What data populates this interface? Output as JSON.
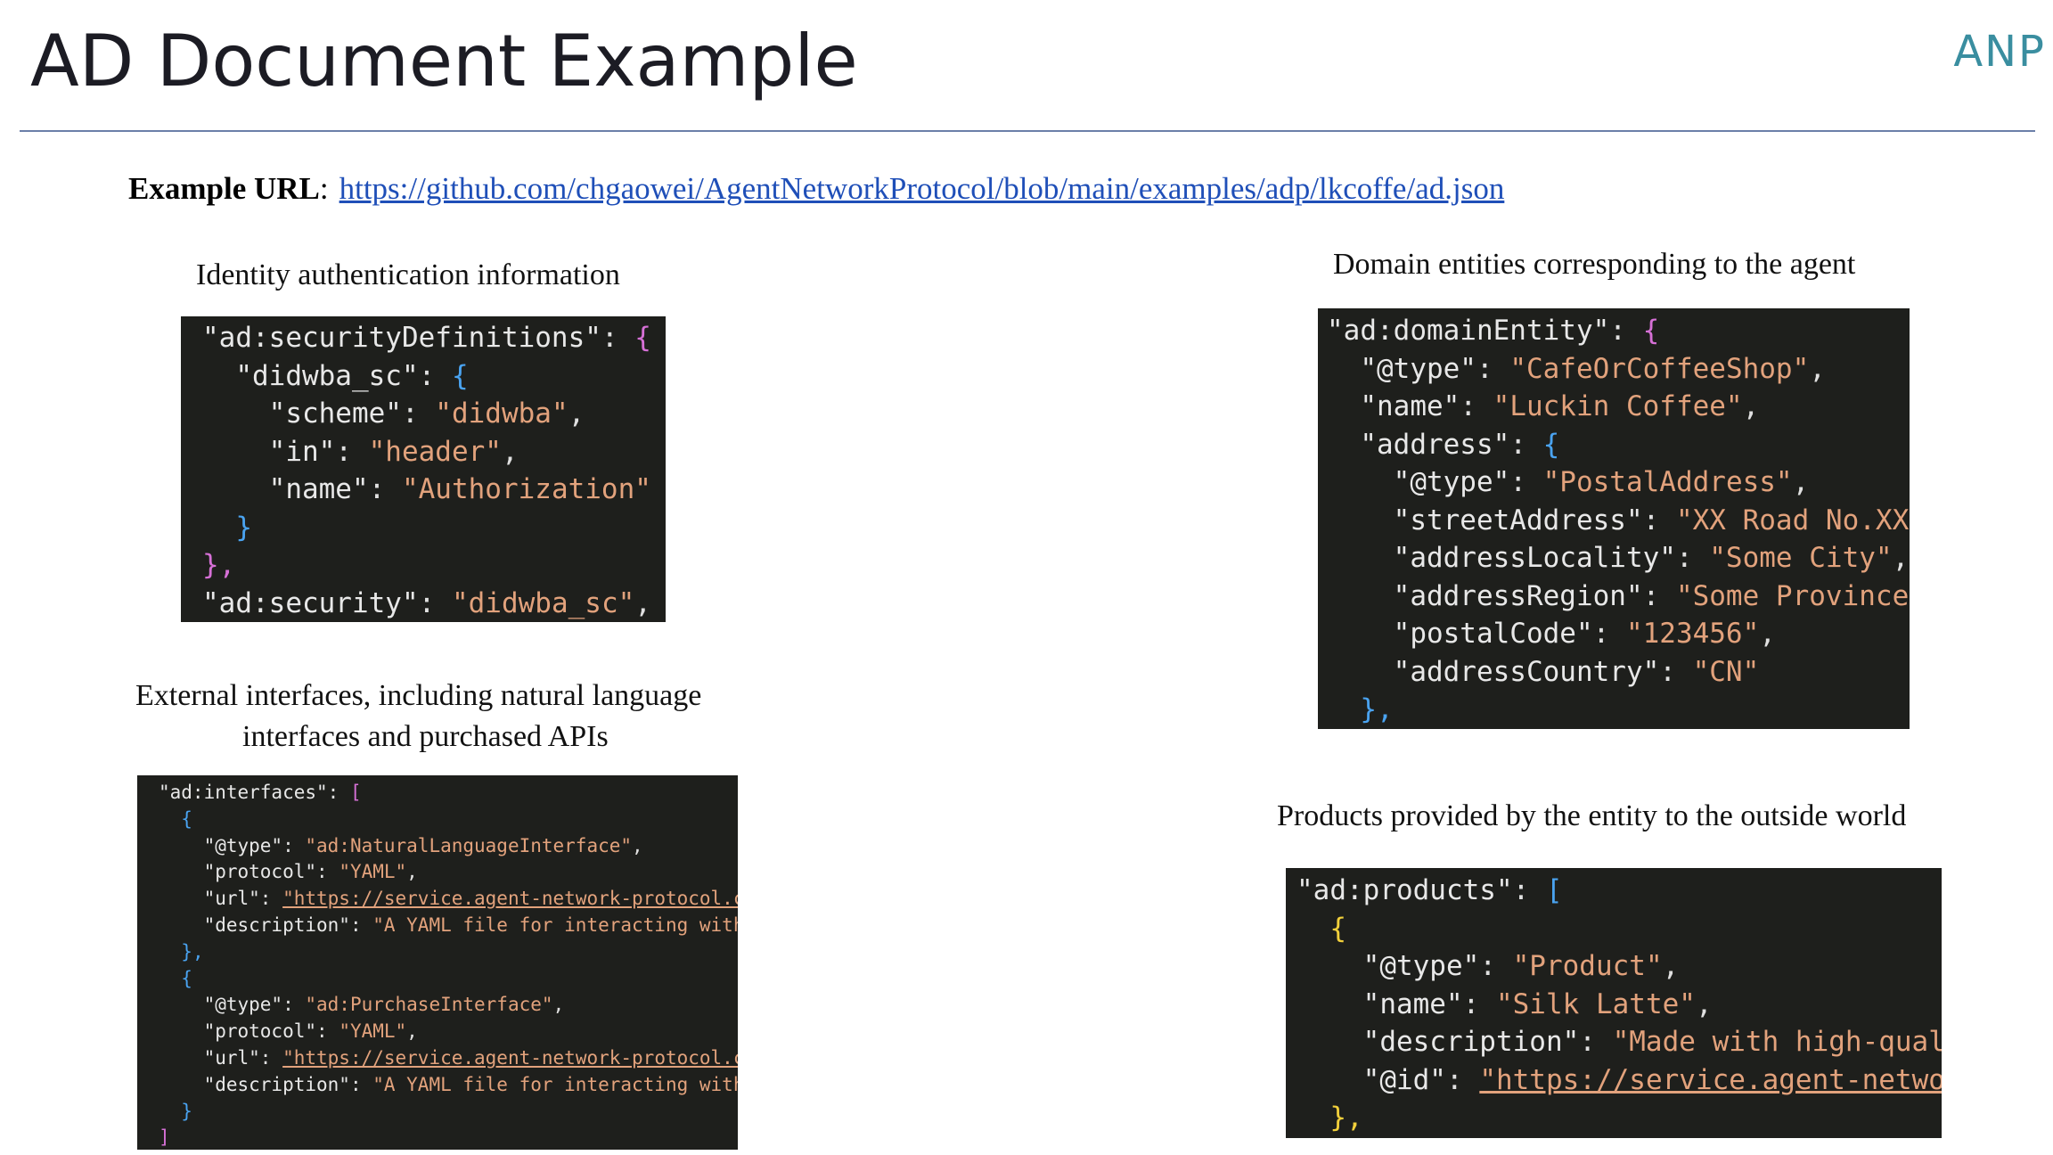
{
  "header": {
    "title": "AD Document Example",
    "logo_text": "ANP",
    "logo_color": "#3a8ea0"
  },
  "example_url": {
    "label": "Example URL",
    "separator": ":",
    "href": "https://github.com/chgaowei/AgentNetworkProtocol/blob/main/examples/adp/lkcoffe/ad.json"
  },
  "captions": {
    "identity": "Identity authentication information",
    "external_line1": "External interfaces, including natural language",
    "external_line2": "interfaces and purchased APIs",
    "domain": "Domain entities corresponding to the agent",
    "products": "Products provided by the entity to the outside world"
  },
  "code_security": [
    [
      "\"ad:securityDefinitions\"",
      ": ",
      "",
      "{",
      "b1"
    ],
    [
      "  \"didwba_sc\"",
      ": ",
      "",
      "{",
      "b2"
    ],
    [
      "    \"scheme\"",
      ": ",
      "\"didwba\"",
      ",",
      ""
    ],
    [
      "    \"in\"",
      ": ",
      "\"header\"",
      ",",
      ""
    ],
    [
      "    \"name\"",
      ": ",
      "\"Authorization\"",
      "",
      ""
    ],
    [
      "  ",
      "",
      "",
      "}",
      "b2"
    ],
    [
      "",
      "",
      "",
      "},",
      "b1"
    ],
    [
      "\"ad:security\"",
      ": ",
      "\"didwba_sc\"",
      ",",
      ""
    ]
  ],
  "code_interfaces": [
    [
      "\"ad:interfaces\"",
      ": ",
      "",
      "[",
      "b1"
    ],
    [
      "  ",
      "",
      "",
      "{",
      "b2"
    ],
    [
      "    \"@type\"",
      ": ",
      "\"ad:NaturalLanguageInterface\"",
      ",",
      ""
    ],
    [
      "    \"protocol\"",
      ": ",
      "\"YAML\"",
      ",",
      ""
    ],
    [
      "    \"url\"",
      ": ",
      "\"https://service.agent-network-protocol.com/",
      "",
      "u"
    ],
    [
      "    \"description\"",
      ": ",
      "\"A YAML file for interacting with th",
      "",
      ""
    ],
    [
      "  ",
      "",
      "",
      "},",
      "b2"
    ],
    [
      "  ",
      "",
      "",
      "{",
      "b2"
    ],
    [
      "    \"@type\"",
      ": ",
      "\"ad:PurchaseInterface\"",
      ",",
      ""
    ],
    [
      "    \"protocol\"",
      ": ",
      "\"YAML\"",
      ",",
      ""
    ],
    [
      "    \"url\"",
      ": ",
      "\"https://service.agent-network-protocol.com/",
      "",
      "u"
    ],
    [
      "    \"description\"",
      ": ",
      "\"A YAML file for interacting with th",
      "",
      ""
    ],
    [
      "  ",
      "",
      "",
      "}",
      "b2"
    ],
    [
      "",
      "",
      "",
      "]",
      "b1"
    ]
  ],
  "code_domain": [
    [
      "\"ad:domainEntity\"",
      ": ",
      "",
      "{",
      "b1"
    ],
    [
      "  \"@type\"",
      ": ",
      "\"CafeOrCoffeeShop\"",
      ",",
      ""
    ],
    [
      "  \"name\"",
      ": ",
      "\"Luckin Coffee\"",
      ",",
      ""
    ],
    [
      "  \"address\"",
      ": ",
      "",
      "{",
      "b2"
    ],
    [
      "    \"@type\"",
      ": ",
      "\"PostalAddress\"",
      ",",
      ""
    ],
    [
      "    \"streetAddress\"",
      ": ",
      "\"XX Road No.XX\"",
      ",",
      ""
    ],
    [
      "    \"addressLocality\"",
      ": ",
      "\"Some City\"",
      ",",
      ""
    ],
    [
      "    \"addressRegion\"",
      ": ",
      "\"Some Province\"",
      ",",
      ""
    ],
    [
      "    \"postalCode\"",
      ": ",
      "\"123456\"",
      ",",
      ""
    ],
    [
      "    \"addressCountry\"",
      ": ",
      "\"CN\"",
      "",
      ""
    ],
    [
      "  ",
      "",
      "",
      "},",
      "b2"
    ]
  ],
  "code_products": [
    [
      "\"ad:products\"",
      ": ",
      "",
      "[",
      "b2"
    ],
    [
      "  ",
      "",
      "",
      "{",
      "b3"
    ],
    [
      "    \"@type\"",
      ": ",
      "\"Product\"",
      ",",
      ""
    ],
    [
      "    \"name\"",
      ": ",
      "\"Silk Latte\"",
      ",",
      ""
    ],
    [
      "    \"description\"",
      ": ",
      "\"Made with high-quality",
      "",
      ""
    ],
    [
      "    \"@id\"",
      ": ",
      "\"https://service.agent-network-p",
      "",
      "u"
    ],
    [
      "  ",
      "",
      "",
      "},",
      "b3"
    ]
  ]
}
